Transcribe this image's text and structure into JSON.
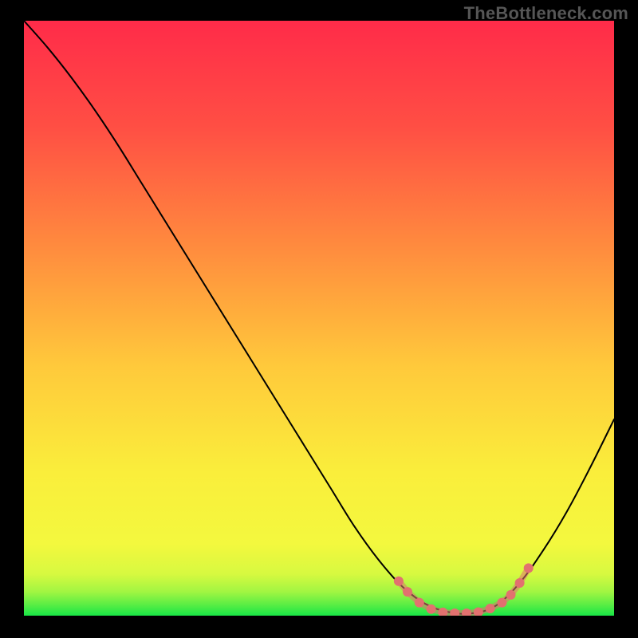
{
  "watermark": "TheBottleneck.com",
  "chart_data": {
    "type": "line",
    "title": "",
    "xlabel": "",
    "ylabel": "",
    "xlim": [
      0,
      100
    ],
    "ylim": [
      0,
      100
    ],
    "grid": false,
    "legend": false,
    "background_gradient": {
      "top_color": "#FF2B49",
      "mid_colors": [
        "#FF7A3E",
        "#FFC93B",
        "#F6F23B"
      ],
      "bottom_color": "#19E646"
    },
    "series": [
      {
        "name": "bottleneck-curve",
        "stroke": "#000000",
        "x": [
          0,
          4,
          8,
          12,
          16,
          20,
          24,
          28,
          32,
          36,
          40,
          44,
          48,
          52,
          56,
          60,
          64,
          68,
          72,
          76,
          80,
          84,
          88,
          92,
          96,
          100
        ],
        "y": [
          100,
          95.5,
          90.5,
          85,
          79,
          72.6,
          66.2,
          59.8,
          53.4,
          47,
          40.6,
          34.2,
          27.8,
          21.4,
          15,
          9.5,
          5,
          2,
          0.6,
          0.4,
          1.7,
          5.5,
          11,
          17.5,
          25,
          33
        ]
      },
      {
        "name": "highlight-dots",
        "stroke": "#E2716F",
        "marker": "circle",
        "x": [
          63.5,
          65,
          67,
          69,
          71,
          73,
          75,
          77,
          79,
          81,
          82.5,
          84,
          85.5
        ],
        "y": [
          5.8,
          4.0,
          2.2,
          1.1,
          0.55,
          0.4,
          0.4,
          0.6,
          1.2,
          2.2,
          3.5,
          5.5,
          8.0
        ]
      }
    ]
  }
}
